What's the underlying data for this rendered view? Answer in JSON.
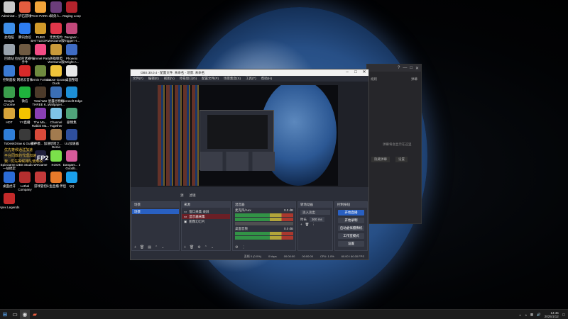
{
  "desktop_icons": [
    {
      "label": "Administr...",
      "color": "#c9c9c9"
    },
    {
      "label": "护石游戏",
      "color": "#e35d3f"
    },
    {
      "label": "PICO PARK 2",
      "color": "#f2a43a"
    },
    {
      "label": "铸剑人...",
      "color": "#6b3d7a"
    },
    {
      "label": "Raging Loop",
      "color": "#b5232c"
    },
    {
      "label": "此电脑",
      "color": "#3e8ee8"
    },
    {
      "label": "腾讯会议",
      "color": "#2d7cf0"
    },
    {
      "label": "PUBG BATTLEGR...",
      "color": "#d19a2a"
    },
    {
      "label": "无畏契约 WeGame版",
      "color": "#e0364a"
    },
    {
      "label": "Danganr... Trigger H...",
      "color": "#c2487a"
    },
    {
      "label": "回收站",
      "color": "#9aa3ad"
    },
    {
      "label": "拉扯的诱惑 派手牛",
      "color": "#6f5a42"
    },
    {
      "label": "Pummel Party",
      "color": "#f24c85"
    },
    {
      "label": "英雄联盟 WeGame版",
      "color": "#c99a3a"
    },
    {
      "label": "Phoenix Wright A...",
      "color": "#3f6cc4"
    },
    {
      "label": "控制面板",
      "color": "#3b7bd4"
    },
    {
      "label": "网易云音乐",
      "color": "#d82a2a"
    },
    {
      "label": "Remin Fortune ...",
      "color": "#6f8b3f"
    },
    {
      "label": "Goose Goose Duck",
      "color": "#f0c43a"
    },
    {
      "label": "桌面整理",
      "color": "#e8e8e8"
    },
    {
      "label": "Google Chrome",
      "color": "#3a9d4c"
    },
    {
      "label": "微信",
      "color": "#1fb33d"
    },
    {
      "label": "Total War THREE K...",
      "color": "#4c3a2a"
    },
    {
      "label": "星露谷物语 Wallpaper...",
      "color": "#3b6fb5"
    },
    {
      "label": "Microsoft Edge",
      "color": "#1d8fd6"
    },
    {
      "label": "HDT",
      "color": "#d7a43a"
    },
    {
      "label": "YY直播",
      "color": "#f5c400"
    },
    {
      "label": "The Ma... Rabbit Ma...",
      "color": "#8a3fb3"
    },
    {
      "label": "Channel Together",
      "color": "#7fc4e8"
    },
    {
      "label": "剧情集",
      "color": "#4fa37a"
    },
    {
      "label": "ToDesk",
      "color": "#2f7ed8"
    },
    {
      "label": "Draw & Guess - ...",
      "color": "#3a3a3a"
    },
    {
      "label": "雷神模... 加速",
      "color": "#d84a3a"
    },
    {
      "label": "哈哈之... Demo",
      "color": "#a27b4f"
    },
    {
      "label": "UU加速器",
      "color": "#2e4f9e"
    },
    {
      "label": "EpicGame... 一站搞定",
      "color": "#222222"
    },
    {
      "label": "OBS Studio",
      "color": "#303030"
    },
    {
      "label": "WeGame",
      "color": "#1f1f3d"
    },
    {
      "label": "KOOK",
      "color": "#7be04b"
    },
    {
      "label": "Danganr... 2 Goodb...",
      "color": "#d65a9a"
    },
    {
      "label": "桌面虎牙",
      "color": "#2b6cd8"
    },
    {
      "label": "Lethal Company",
      "color": "#b52f2f"
    },
    {
      "label": "游戏管控",
      "color": "#c43a3a"
    },
    {
      "label": "斗鱼直播 伴侣",
      "color": "#e87a2a"
    },
    {
      "label": "QQ",
      "color": "#1aa0ec"
    },
    {
      "label": "Apex Legends",
      "color": "#c42a2a"
    }
  ],
  "overlay_texts": [
    "优先等候通过加速",
    "平台同款的代理加速",
    "我...优先等候排队使用权"
  ],
  "overlay_tag": "FP2",
  "obs": {
    "title": "OBS 30.0.4 - 配置文件: 未命名 - 场景: 未命名",
    "menu": [
      "文件(F)",
      "编辑(E)",
      "视图(V)",
      "停靠窗口(D)",
      "配置文件(P)",
      "场景集合(S)",
      "工具(T)",
      "帮助(H)"
    ],
    "tabs_row": [
      "源",
      "滤镜"
    ],
    "docks": {
      "scenes": {
        "title": "场景",
        "items": [
          "场景"
        ]
      },
      "sources": {
        "title": "来源",
        "items": [
          "窗口采集 录屏",
          "显示器采集",
          "图像幻灯片"
        ]
      },
      "mixer": {
        "title": "混音器",
        "channels": [
          {
            "name": "麦克风/Aux",
            "db": "0.0 dB"
          },
          {
            "name": "桌面音频",
            "db": "0.0 dB"
          }
        ]
      },
      "transitions": {
        "title": "转场动画",
        "type": "淡入淡出",
        "duration_label": "时长",
        "duration": "300 ms"
      },
      "controls": {
        "title": "控制按钮",
        "buttons": [
          "开始直播",
          "开始录制",
          "启动虚拟摄像机",
          "工作室模式",
          "设置"
        ]
      }
    },
    "status": {
      "dropped": "丢帧 0 (0.0%)",
      "bitrate": "0 kbps",
      "live": "00:00:00",
      "rec": "00:00:00",
      "cpu": "CPU: 1.0%",
      "fps": "60.00 / 60.00 FPS"
    }
  },
  "sidewin": {
    "title_icons": [
      "?",
      "—",
      "□",
      "✕"
    ],
    "items": [
      "规则",
      "弹幕"
    ],
    "body": "弹幕将会显示在这里",
    "buttons": [
      "隐藏弹幕",
      "设置"
    ]
  },
  "taskbar": {
    "time": "14:45",
    "date": "2025/1/12"
  }
}
